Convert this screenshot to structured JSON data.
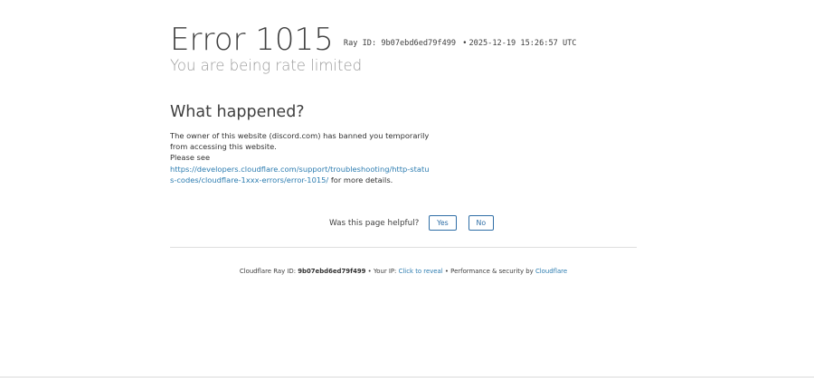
{
  "header": {
    "title": "Error 1015",
    "ray_label": "Ray ID:",
    "ray_id": "9b07ebd6ed79f499",
    "separator": "•",
    "timestamp": "2025-12-19 15:26:57 UTC",
    "subtitle": "You are being rate limited"
  },
  "what_happened": {
    "heading": "What happened?",
    "line1": "The owner of this website (discord.com) has banned you temporarily from accessing this website.",
    "line2": "Please see",
    "link": "https://developers.cloudflare.com/support/troubleshooting/http-status-codes/cloudflare-1xxx-errors/error-1015/",
    "after_link": "for more details."
  },
  "feedback": {
    "question": "Was this page helpful?",
    "yes_label": "Yes",
    "no_label": "No"
  },
  "footer": {
    "ray_label": "Cloudflare Ray ID:",
    "ray_id": "9b07ebd6ed79f499",
    "sep1": "•",
    "ip_label": "Your IP:",
    "reveal_link": "Click to reveal",
    "sep2": "•",
    "perf_label": "Performance & security by",
    "cloudflare_link": "Cloudflare"
  },
  "colors": {
    "link": "#2c7cb0",
    "button_border": "#2f6ea6",
    "subtitle": "#999999"
  }
}
